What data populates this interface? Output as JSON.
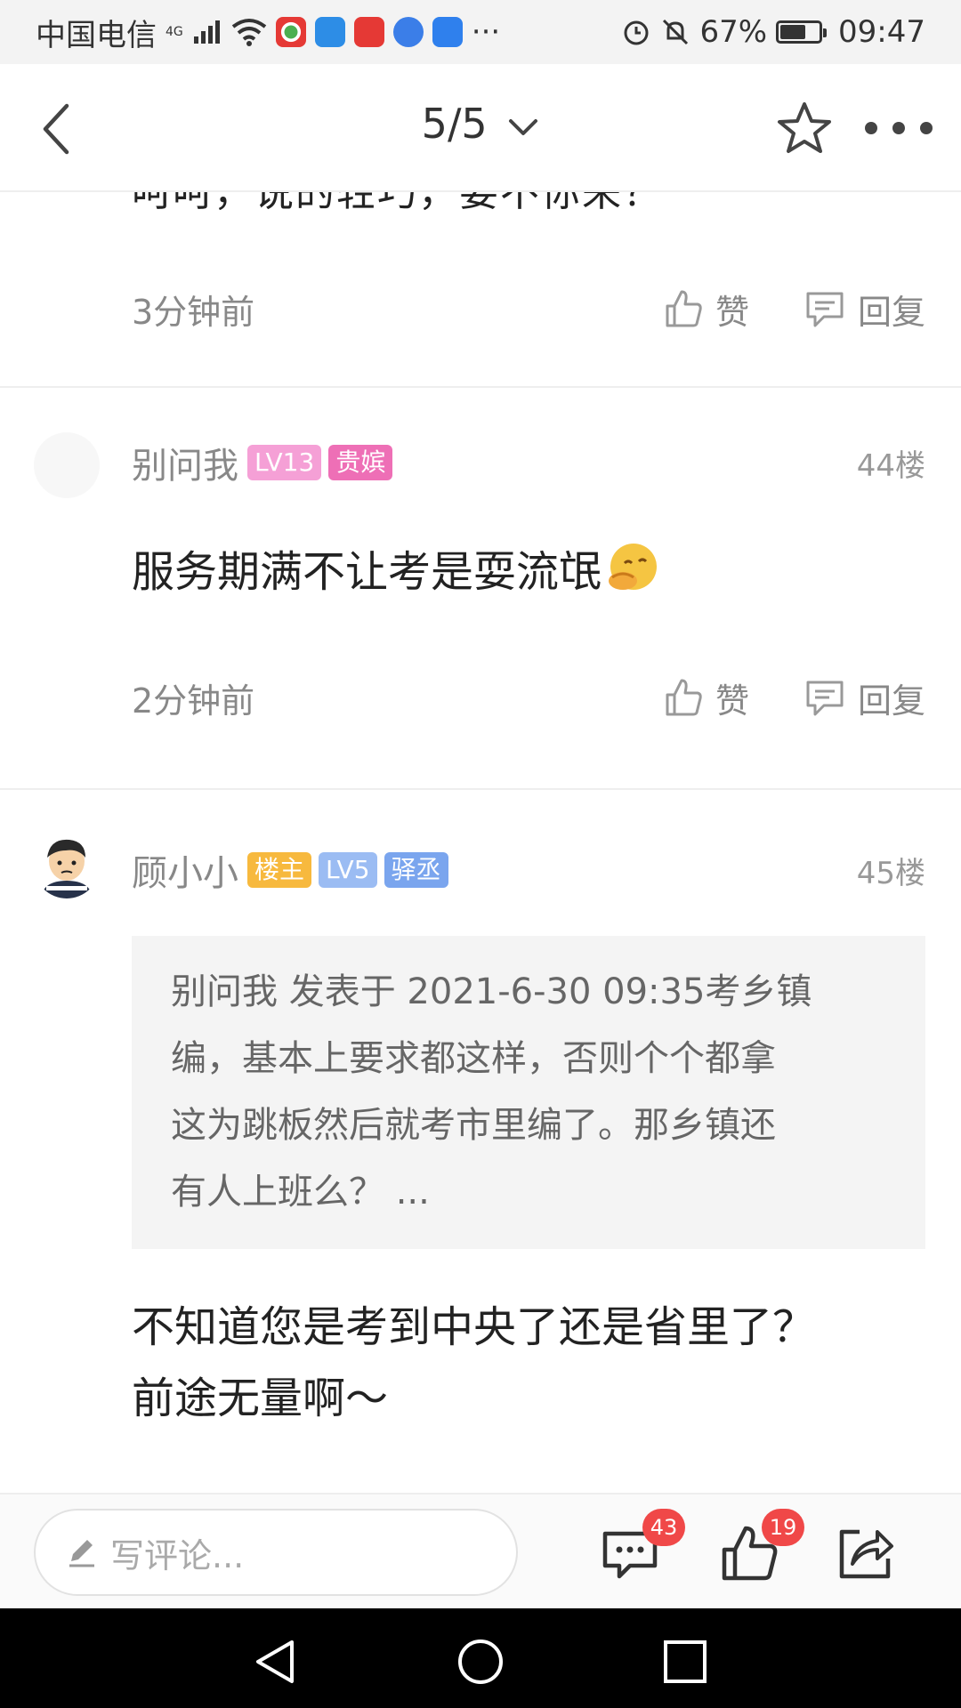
{
  "status_bar": {
    "carrier": "中国电信",
    "network": "4G",
    "more": "···",
    "battery_percent": "67%",
    "battery_level": 0.67,
    "time": "09:47",
    "app_icons": [
      "browser-app-icon",
      "weather-app-icon",
      "gift-app-icon",
      "globe-app-icon",
      "signal-app-icon"
    ]
  },
  "header": {
    "page_indicator": "5/5"
  },
  "previous_post": {
    "cut_text": "呵呵，说的轻巧，要不你来？",
    "time": "3分钟前",
    "like_label": "赞",
    "reply_label": "回复"
  },
  "posts": [
    {
      "author": "别问我",
      "badges": [
        {
          "text": "LV13",
          "color": "#f5a0d6"
        },
        {
          "text": "贵嫔",
          "color": "#ee6fb6"
        }
      ],
      "floor": "44楼",
      "text": "服务期满不让考是耍流氓",
      "time": "2分钟前",
      "like_label": "赞",
      "reply_label": "回复"
    },
    {
      "author": "顾小小",
      "badges": [
        {
          "text": "楼主",
          "color": "#f7b93e"
        },
        {
          "text": "LV5",
          "color": "#9bbcf3"
        },
        {
          "text": "驿丞",
          "color": "#7aa5ee"
        }
      ],
      "floor": "45楼",
      "quote": {
        "lines": [
          "别问我 发表于 2021-6-30 09:35考乡镇",
          "编，基本上要求都这样，否则个个都拿",
          "这为跳板然后就考市里编了。那乡镇还",
          "有人上班么？ ..."
        ]
      },
      "text_lines": [
        "不知道您是考到中央了还是省里了？",
        "前途无量啊～"
      ]
    }
  ],
  "bottom_bar": {
    "comment_placeholder": "写评论...",
    "comment_count": "43",
    "like_count": "19"
  },
  "colors": {
    "accent_badge": "#f04848",
    "meta_gray": "#888888"
  }
}
